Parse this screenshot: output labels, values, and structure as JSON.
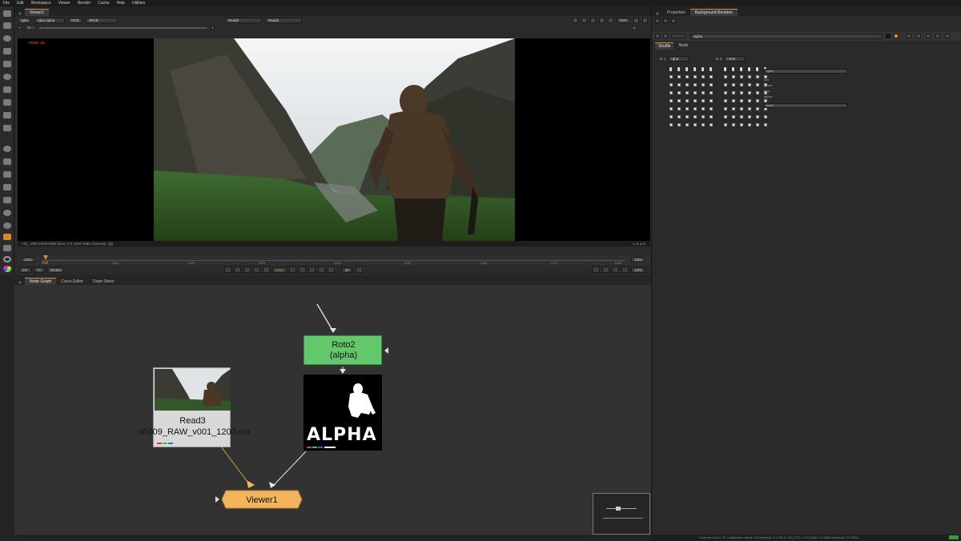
{
  "menu": {
    "items": [
      "File",
      "Edit",
      "Workspace",
      "Viewer",
      "Render",
      "Cache",
      "Help",
      "Utilities"
    ]
  },
  "viewer": {
    "tab_label": "Viewer1",
    "layer": "rgba",
    "channel": "rgba.alpha",
    "colorspace": "RGB",
    "lut": "sRGB",
    "input_a": "Read3",
    "input_b": "Read3",
    "zoom": "52%",
    "gain_value": "1",
    "overlay_text": "mistic da",
    "info_left": "HD_1080 1920x1080 bbox: 0 0 1920 1080 channels: rgb",
    "info_right": "x=0 y=0"
  },
  "timeline": {
    "fps": "24*",
    "mode": "TC",
    "range_mode": "Global",
    "start_frame": "1001",
    "end_frame": "1201",
    "current_frame": "1001",
    "tick_labels": [
      "1001",
      "1025",
      "1051",
      "1075",
      "1100",
      "1125",
      "1150",
      "1175",
      "1200"
    ],
    "playback_frame": "1001",
    "increment": "10",
    "end_field": "1201"
  },
  "properties": {
    "tabs": [
      "Properties",
      "Background Renders"
    ],
    "node_name": "alpha",
    "subtabs": [
      "Shuffle",
      "Node"
    ],
    "in1_label": "in 1",
    "in1_value": "rgba",
    "in2_label": "in 2",
    "in2_value": "none",
    "out_values": [
      "rgba",
      "none"
    ],
    "channel_labels": [
      "red",
      "green",
      "blue",
      "alpha"
    ]
  },
  "graph": {
    "tabs": [
      "Node Graph",
      "Curve Editor",
      "Dope Sheet"
    ],
    "read_node": {
      "name": "Read3",
      "file": "sh009_RAW_v001_1200.exr"
    },
    "roto_node": {
      "name": "Roto2",
      "sub": "(alpha)"
    },
    "alpha_card": {
      "text": "ALPHA"
    },
    "viewer_node": {
      "name": "Viewer1"
    }
  },
  "status": {
    "text": "Channel Count: 70   Localization Mode: On   Memory: 3.2 GB (7.2%)   CPU: 0.2%   Disk: 0.0 MB/s   Network: 0.0 MB/s"
  },
  "colors": {
    "roto": "#63c86b",
    "viewer_node": "#f3b45e",
    "accent": "#d98a2c"
  }
}
